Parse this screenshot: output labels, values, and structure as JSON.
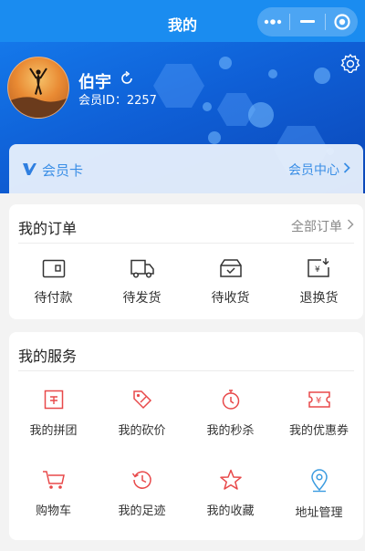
{
  "topbar": {
    "title": "我的"
  },
  "profile": {
    "name": "伯宇",
    "member_id": "会员ID：2257"
  },
  "member_card": {
    "label": "会员卡",
    "center_link": "会员中心"
  },
  "orders": {
    "title": "我的订单",
    "all_link": "全部订单",
    "items": [
      {
        "label": "待付款",
        "icon": "wallet-icon"
      },
      {
        "label": "待发货",
        "icon": "truck-icon"
      },
      {
        "label": "待收货",
        "icon": "package-icon"
      },
      {
        "label": "退换货",
        "icon": "refund-icon"
      }
    ]
  },
  "services": {
    "title": "我的服务",
    "items": [
      {
        "label": "我的拼团",
        "icon": "group-buy-icon"
      },
      {
        "label": "我的砍价",
        "icon": "price-tag-icon"
      },
      {
        "label": "我的秒杀",
        "icon": "stopwatch-icon"
      },
      {
        "label": "我的优惠券",
        "icon": "coupon-icon"
      },
      {
        "label": "购物车",
        "icon": "cart-icon"
      },
      {
        "label": "我的足迹",
        "icon": "history-icon"
      },
      {
        "label": "我的收藏",
        "icon": "star-icon"
      },
      {
        "label": "地址管理",
        "icon": "location-icon"
      }
    ]
  },
  "colors": {
    "primary": "#1a8cf0",
    "accent_red": "#e8494a",
    "accent_blue": "#3a9be0"
  }
}
